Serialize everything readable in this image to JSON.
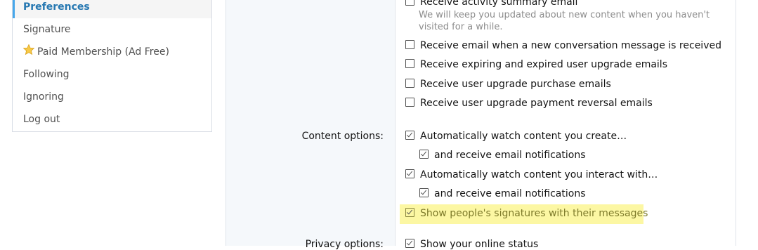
{
  "sidebar": {
    "items": [
      {
        "label": "Preferences",
        "active": true
      },
      {
        "label": "Signature"
      },
      {
        "label": "Paid Membership (Ad Free)",
        "icon": "star-icon"
      },
      {
        "label": "Following"
      },
      {
        "label": "Ignoring"
      },
      {
        "label": "Log out"
      }
    ]
  },
  "email_options": {
    "activity_summary": {
      "label": "Receive activity summary email",
      "hint": "We will keep you updated about new content when you haven't visited for a while.",
      "checked": false
    },
    "conversation": {
      "label": "Receive email when a new conversation message is received",
      "checked": false
    },
    "expiring_upgrade": {
      "label": "Receive expiring and expired user upgrade emails",
      "checked": false
    },
    "upgrade_purchase": {
      "label": "Receive user upgrade purchase emails",
      "checked": false
    },
    "payment_reversal": {
      "label": "Receive user upgrade payment reversal emails",
      "checked": false
    }
  },
  "content_options": {
    "label": "Content options:",
    "watch_create": {
      "label": "Automatically watch content you create…",
      "checked": true
    },
    "watch_create_email": {
      "label": "and receive email notifications",
      "checked": true
    },
    "watch_interact": {
      "label": "Automatically watch content you interact with…",
      "checked": true
    },
    "watch_interact_email": {
      "label": "and receive email notifications",
      "checked": true
    },
    "show_signatures": {
      "label": "Show people's signatures with their messages",
      "checked": true,
      "highlight_color": "#fcf7a3"
    }
  },
  "privacy_options": {
    "label": "Privacy options:",
    "online_status": {
      "label": "Show your online status",
      "checked": true
    }
  }
}
